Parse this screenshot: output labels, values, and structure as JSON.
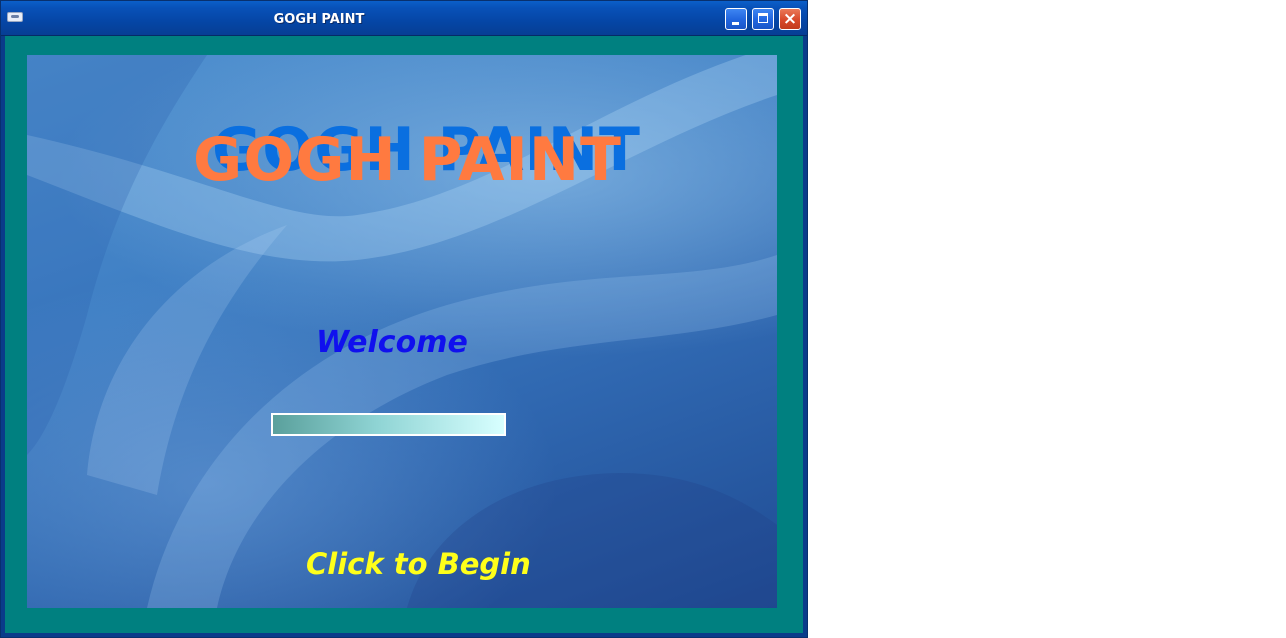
{
  "window": {
    "title": "GOGH PAINT",
    "controls": {
      "minimize": "minimize-icon",
      "maximize": "maximize-icon",
      "close": "×"
    }
  },
  "splash": {
    "logo": "GOGH PAINT",
    "welcome": "Welcome",
    "progress": 1.0,
    "begin_label": "Click to Begin"
  },
  "colors": {
    "client_background": "#008080",
    "logo": "#ff7a40",
    "logo_shadow": "#0a6fe0",
    "welcome": "#1010ee",
    "begin": "#ffff1a",
    "close_button": "#d8482a"
  }
}
